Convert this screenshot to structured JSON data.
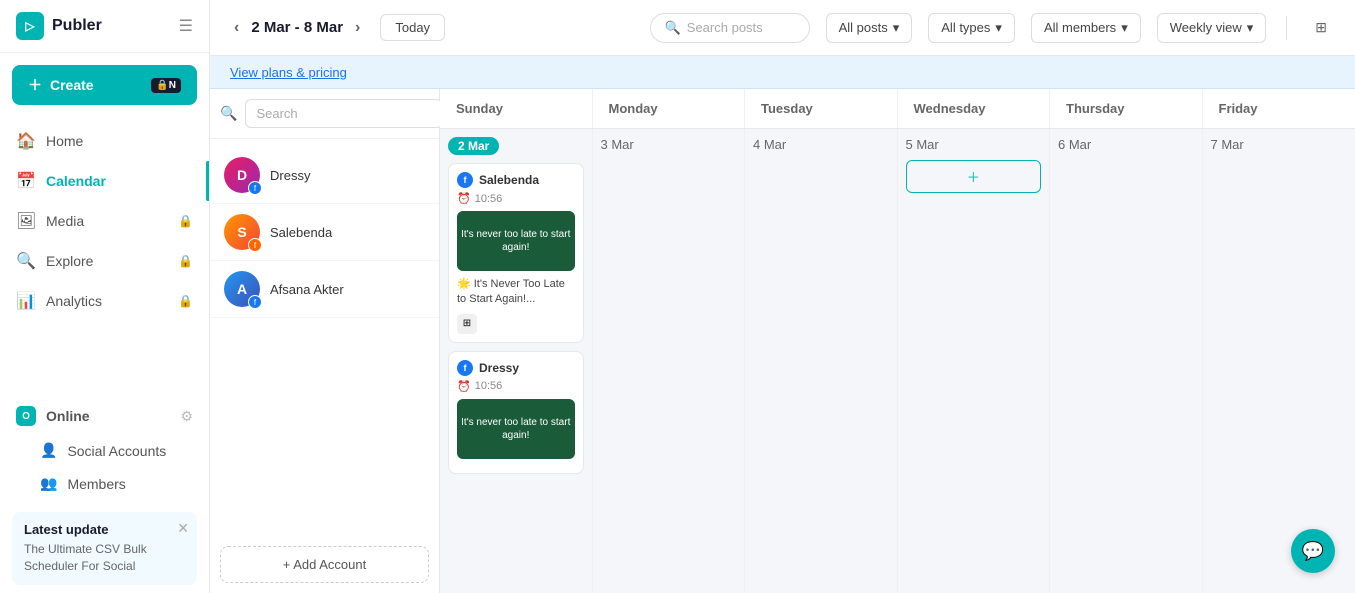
{
  "logo": {
    "icon": "P",
    "text": "Publer"
  },
  "create_button": {
    "label": "Create",
    "badge": "🔒N"
  },
  "nav": {
    "items": [
      {
        "id": "home",
        "label": "Home",
        "icon": "🏠",
        "locked": false,
        "active": false
      },
      {
        "id": "calendar",
        "label": "Calendar",
        "icon": "📅",
        "locked": false,
        "active": true
      },
      {
        "id": "media",
        "label": "Media",
        "icon": "🖼",
        "locked": true,
        "active": false
      },
      {
        "id": "explore",
        "label": "Explore",
        "icon": "🔍",
        "locked": true,
        "active": false
      },
      {
        "id": "analytics",
        "label": "Analytics",
        "icon": "📊",
        "locked": true,
        "active": false
      }
    ]
  },
  "online_section": {
    "label": "Online",
    "dot": "O"
  },
  "sub_nav": {
    "items": [
      {
        "id": "social-accounts",
        "label": "Social Accounts",
        "icon": "👤"
      },
      {
        "id": "members",
        "label": "Members",
        "icon": "👥"
      }
    ]
  },
  "latest_update": {
    "title": "Latest update",
    "text": "The Ultimate CSV Bulk Scheduler For Social"
  },
  "topbar": {
    "date_range": "2 Mar - 8 Mar",
    "today_label": "Today",
    "search_placeholder": "Search posts",
    "filters": [
      {
        "id": "all-posts",
        "label": "All posts"
      },
      {
        "id": "all-types",
        "label": "All types"
      },
      {
        "id": "all-members",
        "label": "All members"
      },
      {
        "id": "weekly-view",
        "label": "Weekly view"
      }
    ]
  },
  "banner": {
    "link_text": "View plans & pricing"
  },
  "account_panel": {
    "search_placeholder": "Search",
    "accounts": [
      {
        "id": "dressy",
        "name": "Dressy",
        "initials": "D",
        "color": "dressy",
        "social": "fb"
      },
      {
        "id": "salebenda",
        "name": "Salebenda",
        "initials": "S",
        "color": "salebenda",
        "social": "fb2"
      },
      {
        "id": "afsana",
        "name": "Afsana Akter",
        "initials": "A",
        "color": "afsana",
        "social": "fb"
      }
    ],
    "add_account_label": "+ Add Account"
  },
  "calendar": {
    "headers": [
      "Sunday",
      "Monday",
      "Tuesday",
      "Wednesday",
      "Thursday",
      "Friday"
    ],
    "days": [
      {
        "date": "2 Mar",
        "highlight": true,
        "posts": [
          {
            "account": "Salebenda",
            "time": "10:56",
            "img_text": "It's never too late to start again!",
            "text": "🌟 It's Never Too Late to Start Again!...",
            "social": "fb"
          },
          {
            "account": "Dressy",
            "time": "10:56",
            "img_text": "It's never too late to start again!",
            "text": "",
            "social": "fb"
          }
        ]
      },
      {
        "date": "3 Mar",
        "highlight": false,
        "posts": []
      },
      {
        "date": "4 Mar",
        "highlight": false,
        "posts": []
      },
      {
        "date": "5 Mar",
        "highlight": false,
        "posts": [],
        "show_add": true
      },
      {
        "date": "6 Mar",
        "highlight": false,
        "posts": []
      },
      {
        "date": "7 Mar",
        "highlight": false,
        "posts": []
      }
    ]
  },
  "chat_button": {
    "icon": "💬"
  }
}
